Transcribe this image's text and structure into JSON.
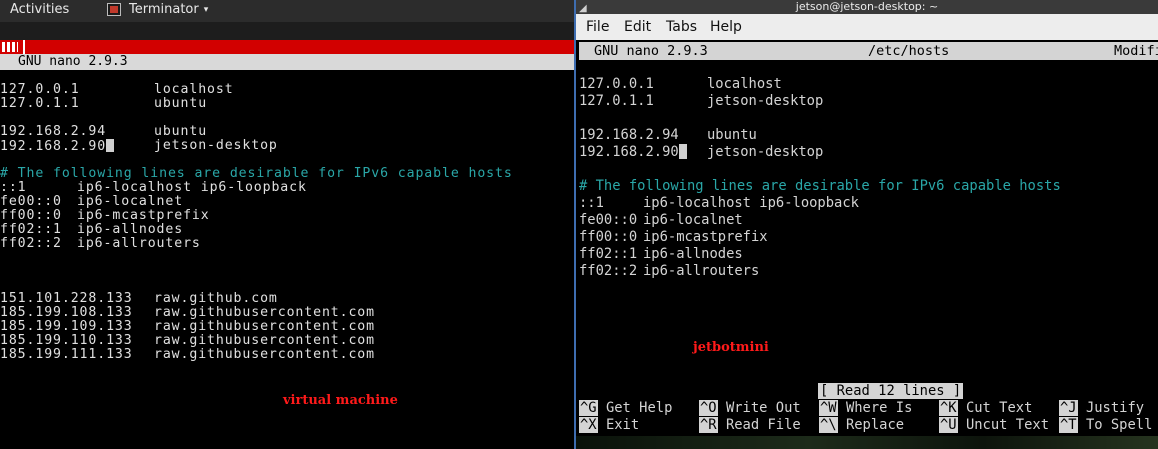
{
  "left": {
    "topbar": {
      "activities": "Activities",
      "app_name": "Terminator",
      "app_caret": "▾"
    },
    "nano_title": "GNU nano 2.9.3",
    "hosts": [
      {
        "ip": "127.0.0.1",
        "name": "localhost"
      },
      {
        "ip": "127.0.1.1",
        "name": "ubuntu"
      },
      {
        "ip": "192.168.2.94",
        "name": "ubuntu"
      },
      {
        "ip": "192.168.2.90",
        "name": "jetson-desktop"
      }
    ],
    "comment": "# The following lines are desirable for IPv6 capable hosts",
    "ipv6": [
      {
        "ip": "::1",
        "name": "ip6-localhost ip6-loopback"
      },
      {
        "ip": "fe00::0",
        "name": "ip6-localnet"
      },
      {
        "ip": "ff00::0",
        "name": "ip6-mcastprefix"
      },
      {
        "ip": "ff02::1",
        "name": "ip6-allnodes"
      },
      {
        "ip": "ff02::2",
        "name": "ip6-allrouters"
      }
    ],
    "github": [
      {
        "ip": "151.101.228.133",
        "name": "raw.github.com"
      },
      {
        "ip": "185.199.108.133",
        "name": "raw.githubusercontent.com"
      },
      {
        "ip": "185.199.109.133",
        "name": "raw.githubusercontent.com"
      },
      {
        "ip": "185.199.110.133",
        "name": "raw.githubusercontent.com"
      },
      {
        "ip": "185.199.111.133",
        "name": "raw.githubusercontent.com"
      }
    ],
    "caption": "virtual machine"
  },
  "right": {
    "window_title": "jetson@jetson-desktop: ~",
    "window_icon": "◢",
    "menu": {
      "file": "File",
      "edit": "Edit",
      "tabs": "Tabs",
      "help": "Help"
    },
    "nano_header": {
      "version": "GNU nano 2.9.3",
      "filename": "/etc/hosts",
      "status": "Modifi"
    },
    "hosts": [
      {
        "ip": "127.0.0.1",
        "name": "localhost"
      },
      {
        "ip": "127.0.1.1",
        "name": "jetson-desktop"
      },
      {
        "ip": "192.168.2.94",
        "name": "ubuntu"
      },
      {
        "ip": "192.168.2.90",
        "name": "jetson-desktop"
      }
    ],
    "comment": "# The following lines are desirable for IPv6 capable hosts",
    "ipv6": [
      {
        "ip": "::1",
        "name": "ip6-localhost ip6-loopback"
      },
      {
        "ip": "fe00::0",
        "name": "ip6-localnet"
      },
      {
        "ip": "ff00::0",
        "name": "ip6-mcastprefix"
      },
      {
        "ip": "ff02::1",
        "name": "ip6-allnodes"
      },
      {
        "ip": "ff02::2",
        "name": "ip6-allrouters"
      }
    ],
    "caption": "jetbotmini",
    "status_message": "[ Read 12 lines ]",
    "shortcuts": [
      {
        "key": "^G",
        "label": "Get Help"
      },
      {
        "key": "^O",
        "label": "Write Out"
      },
      {
        "key": "^W",
        "label": "Where Is"
      },
      {
        "key": "^K",
        "label": "Cut Text"
      },
      {
        "key": "^J",
        "label": "Justify"
      },
      {
        "key": "^X",
        "label": "Exit"
      },
      {
        "key": "^R",
        "label": "Read File"
      },
      {
        "key": "^\\",
        "label": "Replace"
      },
      {
        "key": "^U",
        "label": "Uncut Text"
      },
      {
        "key": "^T",
        "label": "To Spell"
      }
    ]
  },
  "colors": {
    "comment": "#2aa7a8",
    "caption_red": "#ff1a1a",
    "terminator_red": "#d20000",
    "divider": "#3e6db0"
  }
}
